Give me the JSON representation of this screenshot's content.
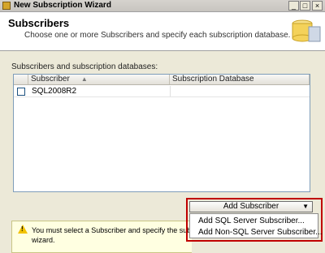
{
  "window": {
    "title": "New Subscription Wizard",
    "minimize_glyph": "_",
    "maximize_glyph": "□",
    "close_glyph": "×"
  },
  "header": {
    "title": "Subscribers",
    "subtitle": "Choose one or more Subscribers and specify each subscription database."
  },
  "main": {
    "section_label": "Subscribers and subscription databases:",
    "table": {
      "columns": [
        "",
        "Subscriber",
        "Subscription Database"
      ],
      "sort_indicator": "▲",
      "rows": [
        {
          "checked": false,
          "subscriber": "SQL2008R2",
          "database": ""
        }
      ]
    },
    "add_button": {
      "label": "Add Subscriber",
      "caret": "▼"
    },
    "menu_items": [
      "Add SQL Server Subscriber...",
      "Add Non-SQL Server Subscriber..."
    ],
    "warning": {
      "icon": "warning-icon",
      "bang": "!",
      "text": "You must select a Subscriber and specify the subsc\nwizard."
    }
  },
  "colors": {
    "highlight": "#c00000",
    "warning_bg": "#ffffe1",
    "header_bg": "#ffffff",
    "dialog_bg": "#ece9d8"
  }
}
